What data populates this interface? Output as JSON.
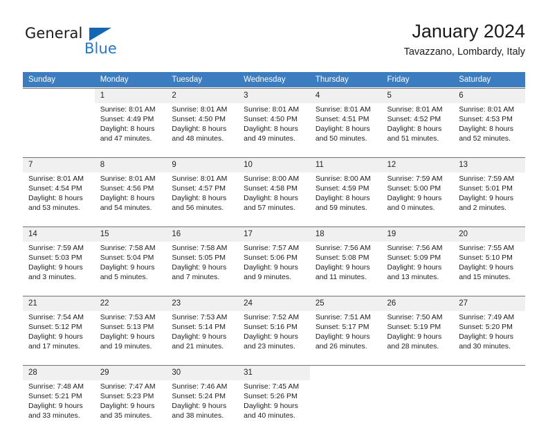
{
  "brand": {
    "name_part1": "General",
    "name_part2": "Blue",
    "accent_color": "#2277c8",
    "triangle_color": "#1267b2"
  },
  "header": {
    "title": "January 2024",
    "subtitle": "Tavazzano, Lombardy, Italy"
  },
  "calendar": {
    "header_bg": "#3b7dc0",
    "daynum_bg": "#f0f0f0",
    "weekdays": [
      "Sunday",
      "Monday",
      "Tuesday",
      "Wednesday",
      "Thursday",
      "Friday",
      "Saturday"
    ],
    "weeks": [
      [
        {
          "day": "",
          "sunrise": "",
          "sunset": "",
          "daylight1": "",
          "daylight2": ""
        },
        {
          "day": "1",
          "sunrise": "Sunrise: 8:01 AM",
          "sunset": "Sunset: 4:49 PM",
          "daylight1": "Daylight: 8 hours",
          "daylight2": "and 47 minutes."
        },
        {
          "day": "2",
          "sunrise": "Sunrise: 8:01 AM",
          "sunset": "Sunset: 4:50 PM",
          "daylight1": "Daylight: 8 hours",
          "daylight2": "and 48 minutes."
        },
        {
          "day": "3",
          "sunrise": "Sunrise: 8:01 AM",
          "sunset": "Sunset: 4:50 PM",
          "daylight1": "Daylight: 8 hours",
          "daylight2": "and 49 minutes."
        },
        {
          "day": "4",
          "sunrise": "Sunrise: 8:01 AM",
          "sunset": "Sunset: 4:51 PM",
          "daylight1": "Daylight: 8 hours",
          "daylight2": "and 50 minutes."
        },
        {
          "day": "5",
          "sunrise": "Sunrise: 8:01 AM",
          "sunset": "Sunset: 4:52 PM",
          "daylight1": "Daylight: 8 hours",
          "daylight2": "and 51 minutes."
        },
        {
          "day": "6",
          "sunrise": "Sunrise: 8:01 AM",
          "sunset": "Sunset: 4:53 PM",
          "daylight1": "Daylight: 8 hours",
          "daylight2": "and 52 minutes."
        }
      ],
      [
        {
          "day": "7",
          "sunrise": "Sunrise: 8:01 AM",
          "sunset": "Sunset: 4:54 PM",
          "daylight1": "Daylight: 8 hours",
          "daylight2": "and 53 minutes."
        },
        {
          "day": "8",
          "sunrise": "Sunrise: 8:01 AM",
          "sunset": "Sunset: 4:56 PM",
          "daylight1": "Daylight: 8 hours",
          "daylight2": "and 54 minutes."
        },
        {
          "day": "9",
          "sunrise": "Sunrise: 8:01 AM",
          "sunset": "Sunset: 4:57 PM",
          "daylight1": "Daylight: 8 hours",
          "daylight2": "and 56 minutes."
        },
        {
          "day": "10",
          "sunrise": "Sunrise: 8:00 AM",
          "sunset": "Sunset: 4:58 PM",
          "daylight1": "Daylight: 8 hours",
          "daylight2": "and 57 minutes."
        },
        {
          "day": "11",
          "sunrise": "Sunrise: 8:00 AM",
          "sunset": "Sunset: 4:59 PM",
          "daylight1": "Daylight: 8 hours",
          "daylight2": "and 59 minutes."
        },
        {
          "day": "12",
          "sunrise": "Sunrise: 7:59 AM",
          "sunset": "Sunset: 5:00 PM",
          "daylight1": "Daylight: 9 hours",
          "daylight2": "and 0 minutes."
        },
        {
          "day": "13",
          "sunrise": "Sunrise: 7:59 AM",
          "sunset": "Sunset: 5:01 PM",
          "daylight1": "Daylight: 9 hours",
          "daylight2": "and 2 minutes."
        }
      ],
      [
        {
          "day": "14",
          "sunrise": "Sunrise: 7:59 AM",
          "sunset": "Sunset: 5:03 PM",
          "daylight1": "Daylight: 9 hours",
          "daylight2": "and 3 minutes."
        },
        {
          "day": "15",
          "sunrise": "Sunrise: 7:58 AM",
          "sunset": "Sunset: 5:04 PM",
          "daylight1": "Daylight: 9 hours",
          "daylight2": "and 5 minutes."
        },
        {
          "day": "16",
          "sunrise": "Sunrise: 7:58 AM",
          "sunset": "Sunset: 5:05 PM",
          "daylight1": "Daylight: 9 hours",
          "daylight2": "and 7 minutes."
        },
        {
          "day": "17",
          "sunrise": "Sunrise: 7:57 AM",
          "sunset": "Sunset: 5:06 PM",
          "daylight1": "Daylight: 9 hours",
          "daylight2": "and 9 minutes."
        },
        {
          "day": "18",
          "sunrise": "Sunrise: 7:56 AM",
          "sunset": "Sunset: 5:08 PM",
          "daylight1": "Daylight: 9 hours",
          "daylight2": "and 11 minutes."
        },
        {
          "day": "19",
          "sunrise": "Sunrise: 7:56 AM",
          "sunset": "Sunset: 5:09 PM",
          "daylight1": "Daylight: 9 hours",
          "daylight2": "and 13 minutes."
        },
        {
          "day": "20",
          "sunrise": "Sunrise: 7:55 AM",
          "sunset": "Sunset: 5:10 PM",
          "daylight1": "Daylight: 9 hours",
          "daylight2": "and 15 minutes."
        }
      ],
      [
        {
          "day": "21",
          "sunrise": "Sunrise: 7:54 AM",
          "sunset": "Sunset: 5:12 PM",
          "daylight1": "Daylight: 9 hours",
          "daylight2": "and 17 minutes."
        },
        {
          "day": "22",
          "sunrise": "Sunrise: 7:53 AM",
          "sunset": "Sunset: 5:13 PM",
          "daylight1": "Daylight: 9 hours",
          "daylight2": "and 19 minutes."
        },
        {
          "day": "23",
          "sunrise": "Sunrise: 7:53 AM",
          "sunset": "Sunset: 5:14 PM",
          "daylight1": "Daylight: 9 hours",
          "daylight2": "and 21 minutes."
        },
        {
          "day": "24",
          "sunrise": "Sunrise: 7:52 AM",
          "sunset": "Sunset: 5:16 PM",
          "daylight1": "Daylight: 9 hours",
          "daylight2": "and 23 minutes."
        },
        {
          "day": "25",
          "sunrise": "Sunrise: 7:51 AM",
          "sunset": "Sunset: 5:17 PM",
          "daylight1": "Daylight: 9 hours",
          "daylight2": "and 26 minutes."
        },
        {
          "day": "26",
          "sunrise": "Sunrise: 7:50 AM",
          "sunset": "Sunset: 5:19 PM",
          "daylight1": "Daylight: 9 hours",
          "daylight2": "and 28 minutes."
        },
        {
          "day": "27",
          "sunrise": "Sunrise: 7:49 AM",
          "sunset": "Sunset: 5:20 PM",
          "daylight1": "Daylight: 9 hours",
          "daylight2": "and 30 minutes."
        }
      ],
      [
        {
          "day": "28",
          "sunrise": "Sunrise: 7:48 AM",
          "sunset": "Sunset: 5:21 PM",
          "daylight1": "Daylight: 9 hours",
          "daylight2": "and 33 minutes."
        },
        {
          "day": "29",
          "sunrise": "Sunrise: 7:47 AM",
          "sunset": "Sunset: 5:23 PM",
          "daylight1": "Daylight: 9 hours",
          "daylight2": "and 35 minutes."
        },
        {
          "day": "30",
          "sunrise": "Sunrise: 7:46 AM",
          "sunset": "Sunset: 5:24 PM",
          "daylight1": "Daylight: 9 hours",
          "daylight2": "and 38 minutes."
        },
        {
          "day": "31",
          "sunrise": "Sunrise: 7:45 AM",
          "sunset": "Sunset: 5:26 PM",
          "daylight1": "Daylight: 9 hours",
          "daylight2": "and 40 minutes."
        },
        {
          "day": "",
          "sunrise": "",
          "sunset": "",
          "daylight1": "",
          "daylight2": ""
        },
        {
          "day": "",
          "sunrise": "",
          "sunset": "",
          "daylight1": "",
          "daylight2": ""
        },
        {
          "day": "",
          "sunrise": "",
          "sunset": "",
          "daylight1": "",
          "daylight2": ""
        }
      ]
    ]
  }
}
